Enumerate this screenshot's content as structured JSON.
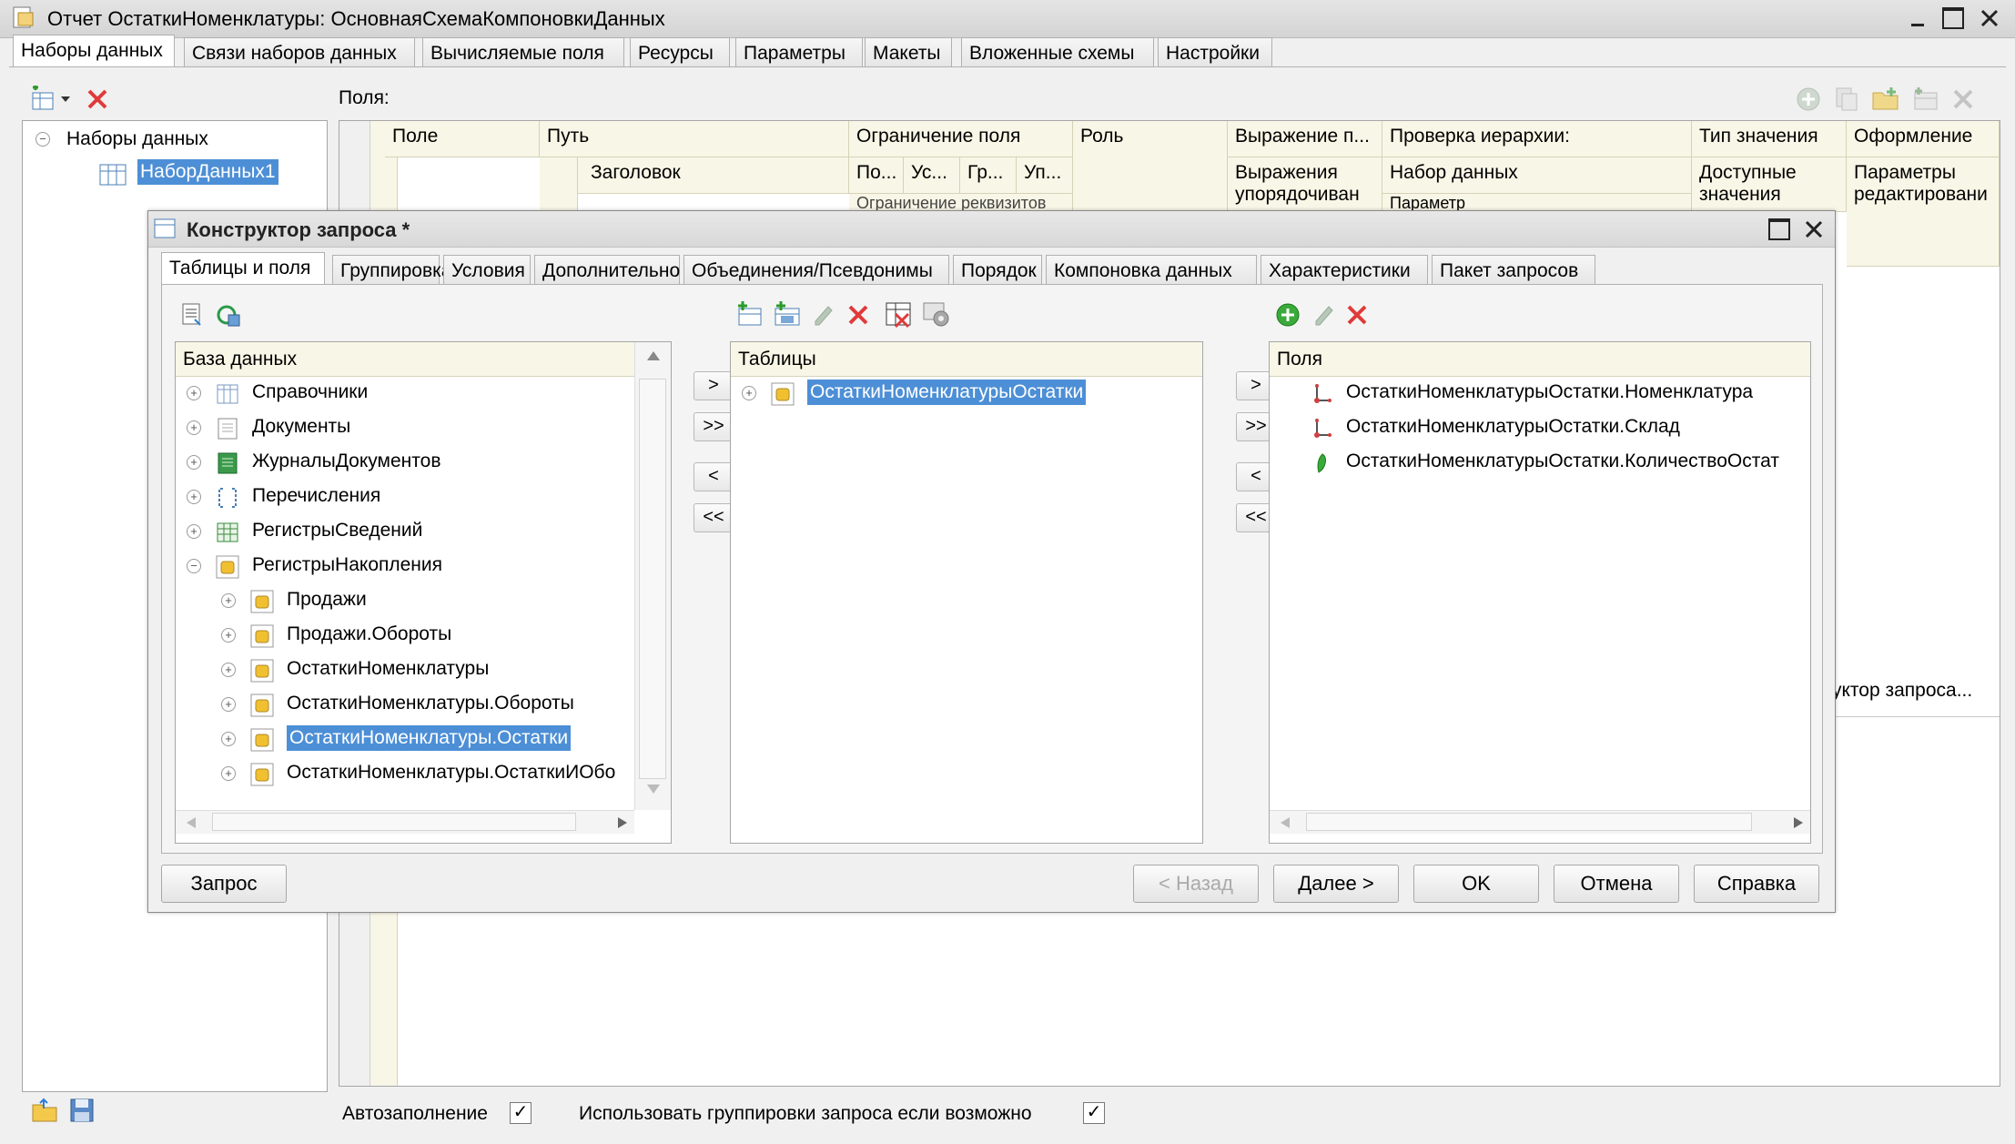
{
  "window": {
    "title": "Отчет ОстаткиНоменклатуры: ОсновнаяСхемаКомпоновкиДанных",
    "tabs": [
      "Наборы данных",
      "Связи наборов данных",
      "Вычисляемые поля",
      "Ресурсы",
      "Параметры",
      "Макеты",
      "Вложенные схемы",
      "Настройки"
    ],
    "active_tab": "Наборы данных"
  },
  "datasets": {
    "root_label": "Наборы данных",
    "item_label": "НаборДанных1"
  },
  "fields": {
    "label": "Поля:",
    "columns": {
      "field": "Поле",
      "path": "Путь",
      "title": "Заголовок",
      "restriction": "Ограничение поля",
      "restr_sub1": "По...",
      "restr_sub2": "Ус...",
      "restr_sub3": "Гр...",
      "restr_sub4": "Уп...",
      "restr_detail": "Ограничение реквизитов",
      "role": "Роль",
      "expression": "Выражение п...",
      "expression_sub": "Выражения упорядочиван",
      "hierarchy": "Проверка иерархии:",
      "hierarchy_sub": "Набор данных",
      "hierarchy_sub2": "Параметр",
      "value_type": "Тип значения",
      "value_type_sub": "Доступные значения",
      "format": "Оформление",
      "format_sub": "Параметры редактировани"
    }
  },
  "query_link": "уктор запроса...",
  "bottom": {
    "autofill_label": "Автозаполнение",
    "autofill_checked": true,
    "use_groupings_label": "Использовать группировки запроса если возможно",
    "use_groupings_checked": true
  },
  "dialog": {
    "title": "Конструктор запроса *",
    "tabs": [
      "Таблицы и поля",
      "Группировка",
      "Условия",
      "Дополнительно",
      "Объединения/Псевдонимы",
      "Порядок",
      "Компоновка данных",
      "Характеристики",
      "Пакет запросов"
    ],
    "active_tab": "Таблицы и поля",
    "database": {
      "header": "База данных",
      "items": [
        {
          "label": "Справочники",
          "icon": "catalog-icon"
        },
        {
          "label": "Документы",
          "icon": "document-icon"
        },
        {
          "label": "ЖурналыДокументов",
          "icon": "journal-icon"
        },
        {
          "label": "Перечисления",
          "icon": "enum-icon"
        },
        {
          "label": "РегистрыСведений",
          "icon": "info-register-icon"
        },
        {
          "label": "РегистрыНакопления",
          "icon": "accum-register-icon"
        },
        {
          "label": "Продажи",
          "icon": "accum-register-icon"
        },
        {
          "label": "Продажи.Обороты",
          "icon": "accum-register-icon"
        },
        {
          "label": "ОстаткиНоменклатуры",
          "icon": "accum-register-icon"
        },
        {
          "label": "ОстаткиНоменклатуры.Обороты",
          "icon": "accum-register-icon"
        },
        {
          "label": "ОстаткиНоменклатуры.Остатки",
          "icon": "accum-register-icon"
        },
        {
          "label": "ОстаткиНоменклатуры.ОстаткиИОбо",
          "icon": "accum-register-icon"
        }
      ]
    },
    "tables": {
      "header": "Таблицы",
      "items": [
        "ОстаткиНоменклатурыОстатки"
      ]
    },
    "fields": {
      "header": "Поля",
      "items": [
        {
          "label": "ОстаткиНоменклатурыОстатки.Номенклатура",
          "icon": "dimension-icon"
        },
        {
          "label": "ОстаткиНоменклатурыОстатки.Склад",
          "icon": "dimension-icon"
        },
        {
          "label": "ОстаткиНоменклатурыОстатки.КоличествоОстат",
          "icon": "resource-icon"
        }
      ]
    },
    "move_buttons": [
      ">",
      ">>",
      "<",
      "<<"
    ],
    "buttons": {
      "query": "Запрос",
      "back": "< Назад",
      "next": "Далее >",
      "ok": "OK",
      "cancel": "Отмена",
      "help": "Справка"
    }
  }
}
